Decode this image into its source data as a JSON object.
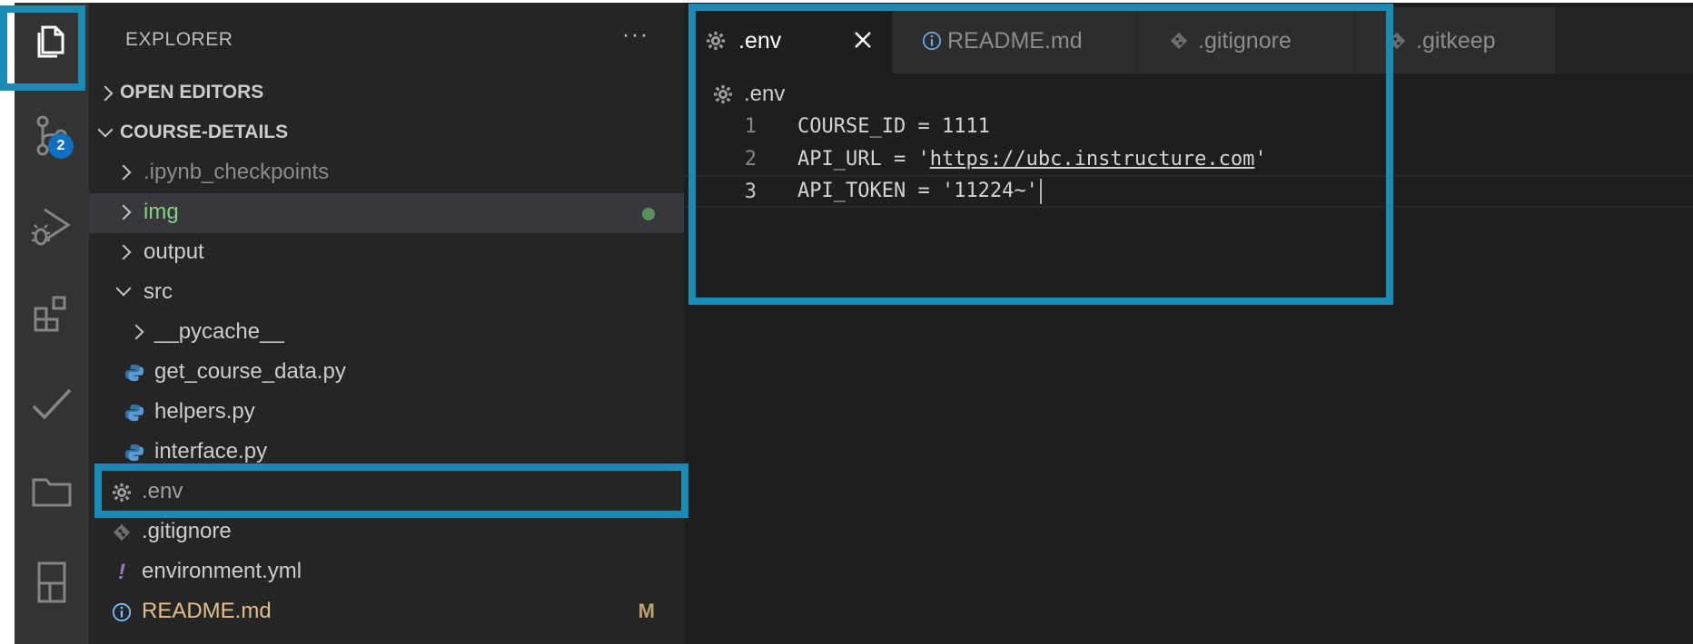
{
  "colors": {
    "highlight": "#1a8bb5",
    "badge": "#0e70c0",
    "modified_folder": "#89d185",
    "modified_file": "#e2c08d",
    "git_dot": "#5a8f5a",
    "yaml_icon": "#a074c4",
    "python_icon": "#3572a5"
  },
  "activity_bar": {
    "items": [
      {
        "icon": "files-icon",
        "active": true
      },
      {
        "icon": "source-control-icon",
        "badge": "2"
      },
      {
        "icon": "run-debug-icon"
      },
      {
        "icon": "extensions-icon"
      },
      {
        "icon": "check-icon"
      },
      {
        "icon": "folder-icon"
      },
      {
        "icon": "notebook-icon"
      }
    ]
  },
  "sidebar": {
    "title": "EXPLORER",
    "more": "···",
    "sections": {
      "open_editors": "OPEN EDITORS",
      "project": "COURSE-DETAILS"
    },
    "tree": [
      {
        "label": ".ipynb_checkpoints",
        "type": "folder",
        "expanded": false
      },
      {
        "label": "img",
        "type": "folder",
        "expanded": false,
        "status": "untracked-dot"
      },
      {
        "label": "output",
        "type": "folder",
        "expanded": false
      },
      {
        "label": "src",
        "type": "folder",
        "expanded": true
      },
      {
        "label": "__pycache__",
        "type": "folder",
        "expanded": false
      },
      {
        "label": "get_course_data.py",
        "type": "python"
      },
      {
        "label": "helpers.py",
        "type": "python"
      },
      {
        "label": "interface.py",
        "type": "python"
      },
      {
        "label": ".env",
        "type": "gear",
        "selected": true
      },
      {
        "label": ".gitignore",
        "type": "git"
      },
      {
        "label": "environment.yml",
        "type": "yaml",
        "icon_text": "!"
      },
      {
        "label": "README.md",
        "type": "info",
        "decoration": "M"
      }
    ]
  },
  "editor": {
    "tabs": [
      {
        "label": ".env",
        "icon": "gear-icon",
        "active": true
      },
      {
        "label": "README.md",
        "icon": "info-icon"
      },
      {
        "label": ".gitignore",
        "icon": "git-icon"
      },
      {
        "label": ".gitkeep",
        "icon": "git-icon"
      }
    ],
    "breadcrumb": ".env",
    "lines": [
      {
        "num": "1",
        "pre": "COURSE_ID = 1111",
        "link": "",
        "post": ""
      },
      {
        "num": "2",
        "pre": "API_URL = '",
        "link": "https://ubc.instructure.com",
        "post": "'"
      },
      {
        "num": "3",
        "pre": "API_TOKEN = '11224~'",
        "link": "",
        "post": ""
      }
    ],
    "current_line": 3
  }
}
